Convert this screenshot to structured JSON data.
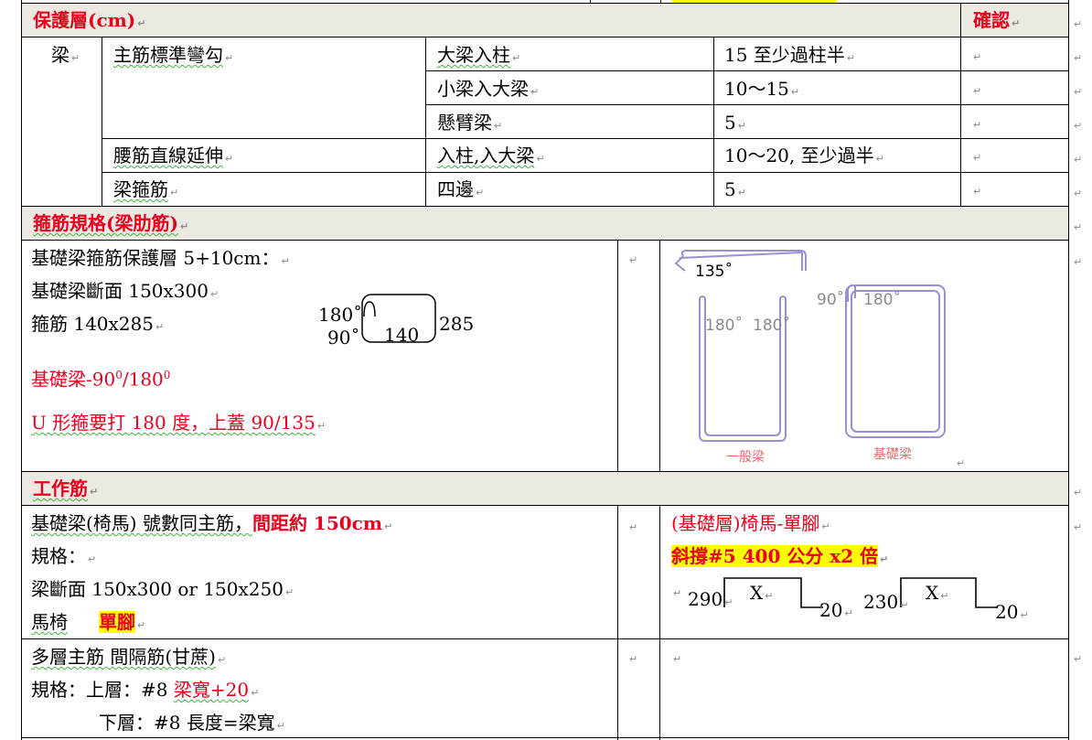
{
  "section_protect": {
    "header": "保護層(cm)",
    "confirm": "確認",
    "row_label": "梁",
    "rows": [
      {
        "item": "主筋標準彎勾",
        "location": "大梁入柱",
        "value": "15 至少過柱半"
      },
      {
        "item": "",
        "location": "小梁入大梁",
        "value": "10～15"
      },
      {
        "item": "",
        "location": "懸臂梁",
        "value": "5"
      },
      {
        "item": "腰筋直線延伸",
        "location": "入柱,入大梁",
        "value": "10～20, 至少過半"
      },
      {
        "item": "梁箍筋",
        "location": "四邊",
        "value": "5"
      }
    ]
  },
  "section_stirrup": {
    "header": "箍筋規格(梁肋筋)",
    "line1": "基礎梁箍筋保護層 5+10cm：",
    "line2": "基礎梁斷面 150x300",
    "line3": "箍筋 140x285",
    "line4_text": "基礎梁-90",
    "line4_sup1": "0",
    "line4_mid": "/180",
    "line4_sup2": "0",
    "line5": "U 形箍要打 180 度，上蓋 90/135",
    "sketch": {
      "a180": "180˚",
      "a90": "90˚",
      "w": "140",
      "h": "285"
    },
    "fig": {
      "t135": "135˚",
      "l180a": "180˚",
      "l180b": "180˚",
      "r90": "90˚",
      "r180": "180˚",
      "cap1": "一般梁",
      "cap2": "基礎梁"
    }
  },
  "section_work": {
    "header": "工作筋",
    "left": {
      "l1a": "基礎梁(椅馬) 號數同主筋，",
      "l1b": "間距約 150cm",
      "l2": "規格：",
      "l3": "梁斷面 150x300 or 150x250",
      "l4a": "馬椅",
      "l4b": "單腳"
    },
    "right": {
      "title": "(基礎層)椅馬-單腳",
      "spec": "斜撐#5 400 公分   x2 倍",
      "d1": {
        "left": "290",
        "x": "X",
        "right": "20"
      },
      "d2": {
        "left": "230",
        "x": "X",
        "right": "20"
      }
    }
  },
  "section_multi": {
    "l1": "多層主筋 間隔筋(甘蔗)",
    "l2a": "規格：上層：#8 ",
    "l2b": "梁寬+20",
    "l3": "下層：#8 長度=梁寬"
  },
  "mark": "↵"
}
